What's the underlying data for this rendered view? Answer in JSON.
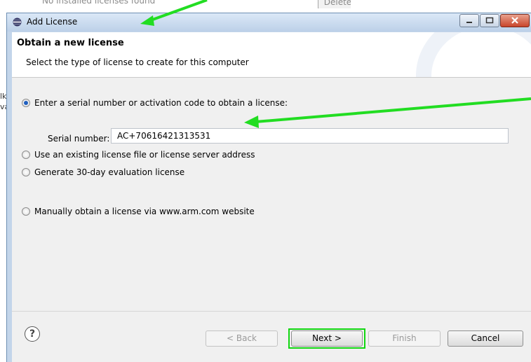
{
  "background": {
    "top_text": "No installed licenses found",
    "top_button": "Delete License",
    "left_fragments": [
      "lk",
      "va"
    ]
  },
  "dialog": {
    "title": "Add License",
    "banner_title": "Obtain a new license",
    "banner_subtitle": "Select the type of license to create for this computer",
    "options": [
      {
        "label": "Enter a serial number or activation code to obtain a license:",
        "checked": true
      },
      {
        "label": "Use an existing license file or license server address",
        "checked": false
      },
      {
        "label": "Generate 30-day evaluation license",
        "checked": false
      },
      {
        "label": "Manually obtain a license via www.arm.com website",
        "checked": false
      }
    ],
    "serial_label": "Serial number:",
    "serial_value": "AC+70616421313531",
    "help_symbol": "?",
    "buttons": {
      "back": "< Back",
      "next": "Next >",
      "finish": "Finish",
      "cancel": "Cancel"
    }
  },
  "colors": {
    "annotation": "#22dd22",
    "radio_selected": "#1f5fbf"
  },
  "icons": [
    "app-globe-icon",
    "minimize-icon",
    "maximize-icon",
    "close-icon",
    "help-icon"
  ]
}
